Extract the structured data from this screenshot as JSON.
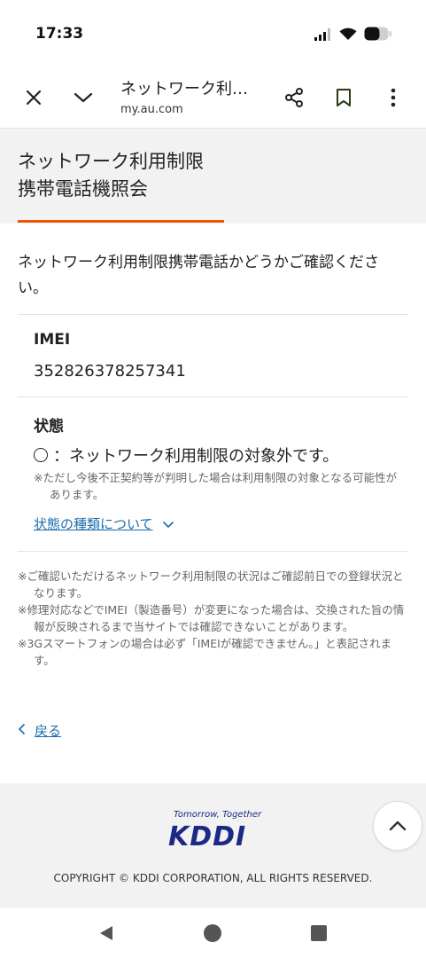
{
  "status_bar": {
    "time": "17:33",
    "icons": [
      "signal-icon",
      "wifi-icon",
      "battery-icon"
    ]
  },
  "toolbar": {
    "title": "ネットワーク利…",
    "url": "my.au.com",
    "icons": [
      "close-icon",
      "chevron-down-icon",
      "share-icon",
      "bookmark-icon",
      "more-vert-icon"
    ]
  },
  "header": {
    "title_line1": "ネットワーク利用制限",
    "title_line2": "携帯電話機照会",
    "accent_color": "#eb5505"
  },
  "intro": "ネットワーク利用制限携帯電話かどうかご確認ください。",
  "imei": {
    "label": "IMEI",
    "value": "352826378257341"
  },
  "state": {
    "label": "状態",
    "result": "：ネットワーク利用制限の対象外です。",
    "note": "※ただし今後不正契約等が判明した場合は利用制限の対象となる可能性があります。",
    "link": "状態の種類について"
  },
  "notes": [
    "※ご確認いただけるネットワーク利用制限の状況はご確認前日での登録状況となります。",
    "※修理対応などでIMEI（製造番号）が変更になった場合は、交換された旨の情報が反映されるまで当サイトでは確認できないことがあります。",
    "※3Gスマートフォンの場合は必ず「IMEIが確認できません。」と表記されます。"
  ],
  "back_link": "戻る",
  "footer": {
    "tagline": "Tomorrow, Together",
    "logo_text": "KDDI",
    "copyright": "COPYRIGHT © KDDI CORPORATION, ALL RIGHTS RESERVED."
  },
  "colors": {
    "link": "#1a6ca8",
    "brand": "#1b2a86",
    "header_bg": "#f2f2f2"
  }
}
